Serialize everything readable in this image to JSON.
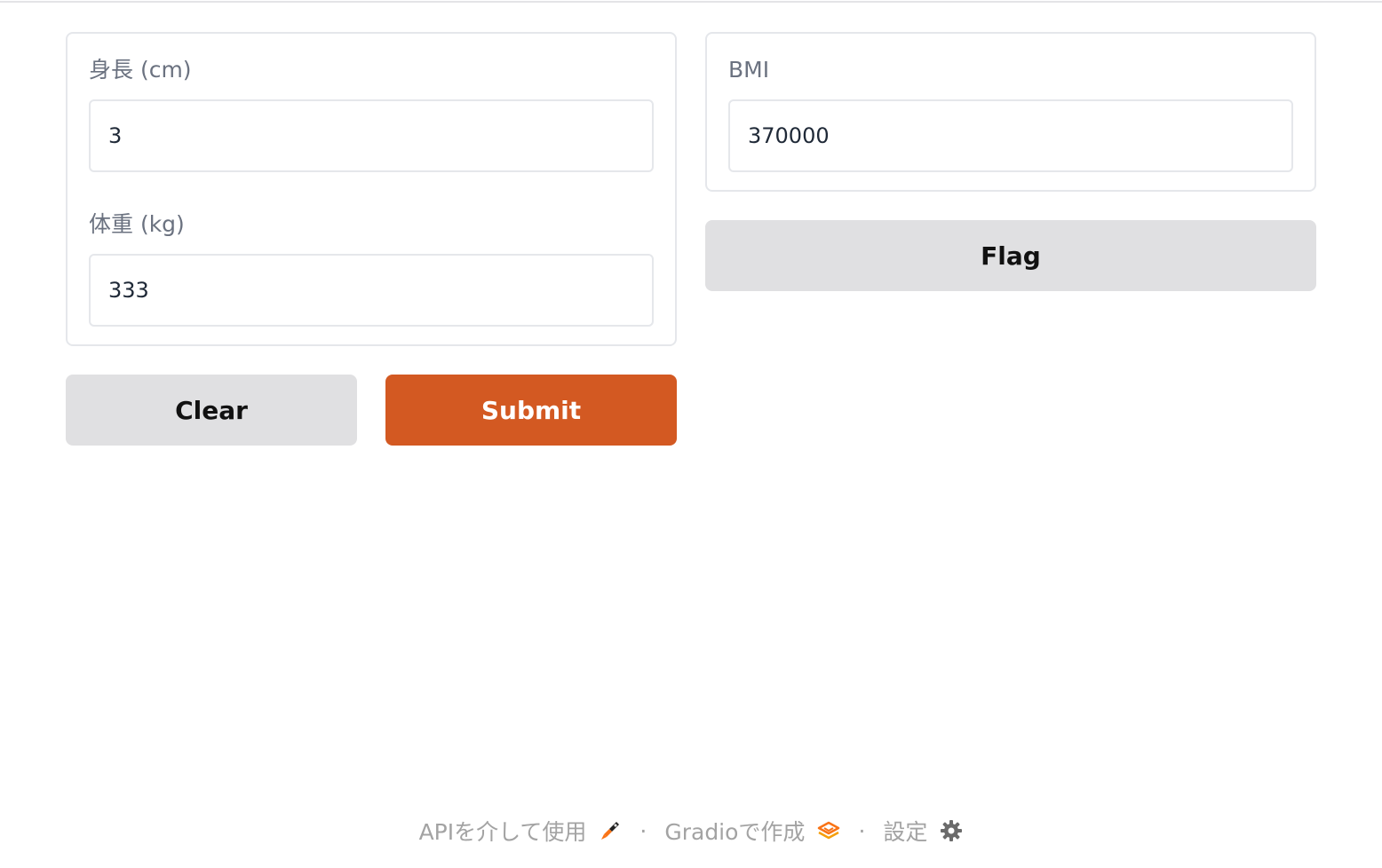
{
  "inputs": {
    "height_label": "身長 (cm)",
    "height_value": "3",
    "weight_label": "体重 (kg)",
    "weight_value": "333"
  },
  "actions": {
    "clear_label": "Clear",
    "submit_label": "Submit"
  },
  "output": {
    "label": "BMI",
    "value": "370000",
    "flag_label": "Flag"
  },
  "footer": {
    "api_label": "APIを介して使用",
    "api_icon": "rocket-icon",
    "separator": "·",
    "built_with_label": "Gradioで作成",
    "built_with_icon": "gradio-logo-icon",
    "settings_label": "設定",
    "settings_icon": "gear-icon"
  },
  "colors": {
    "primary": "#d35922",
    "secondary": "#e0e0e2",
    "border": "#e5e7eb",
    "label": "#6b7280"
  }
}
